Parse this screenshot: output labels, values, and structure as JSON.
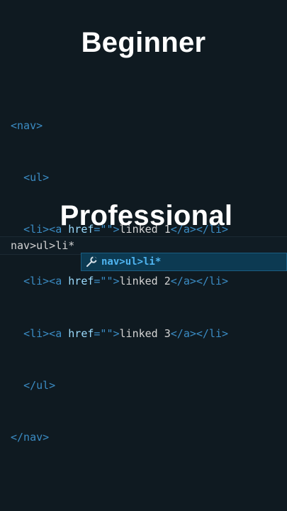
{
  "titles": {
    "beginner": "Beginner",
    "professional": "Professional"
  },
  "code": {
    "line1": {
      "tag": "<nav>"
    },
    "line2": {
      "indent": "  ",
      "tag": "<ul>"
    },
    "line3": {
      "indent": "  ",
      "open": "<li><a ",
      "attr": "href",
      "eq": "=\"\"",
      "close": ">",
      "text": "linked 1",
      "end": "</a></li>"
    },
    "line4": {
      "indent": "  ",
      "open": "<li><a ",
      "attr": "href",
      "eq": "=\"\"",
      "close": ">",
      "text": "linked 2",
      "end": "</a></li>"
    },
    "line5": {
      "indent": "  ",
      "open": "<li><a ",
      "attr": "href",
      "eq": "=\"\"",
      "close": ">",
      "text": "linked 3",
      "end": "</a></li>"
    },
    "line6": {
      "indent": "  ",
      "tag": "</ul>"
    },
    "line7": {
      "tag": "</nav>"
    }
  },
  "editor": {
    "typed": "nav>ul>li*"
  },
  "suggestion": {
    "icon": "wrench-icon",
    "label": "nav>ul>li*"
  },
  "colors": {
    "background": "#0f1a21",
    "tag": "#3b8cc4",
    "attribute": "#9cdcfe",
    "text": "#d4d4d4",
    "suggest_bg": "#0c3a52",
    "suggest_text": "#4fb4f0"
  }
}
